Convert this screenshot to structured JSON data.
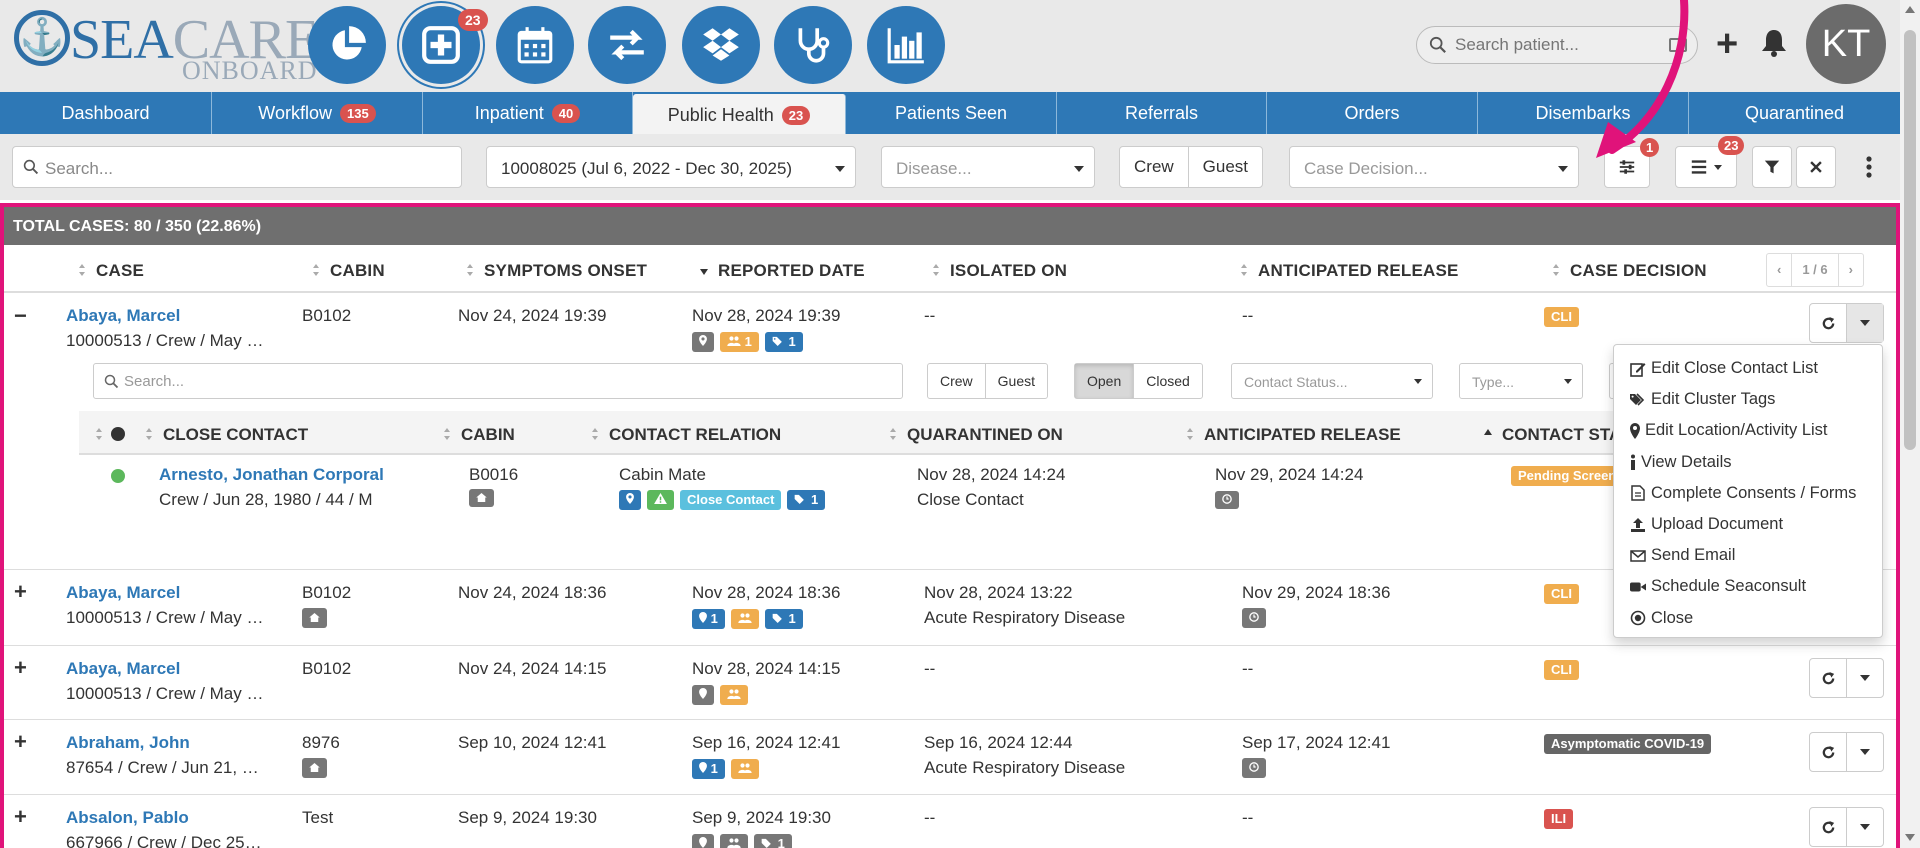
{
  "logo": {
    "sea": "SEA",
    "care": "CARE",
    "sub": "ONBOARD"
  },
  "top_nav": {
    "icons": [
      "pie-chart-icon",
      "add-case-icon",
      "calendar-icon",
      "transfer-icon",
      "dropbox-icon",
      "stethoscope-icon",
      "bar-chart-icon"
    ],
    "badge": "23",
    "search_placeholder": "Search patient...",
    "avatar_initials": "KT"
  },
  "tabs": [
    {
      "label": "Dashboard",
      "badge": ""
    },
    {
      "label": "Workflow",
      "badge": "135"
    },
    {
      "label": "Inpatient",
      "badge": "40"
    },
    {
      "label": "Public Health",
      "badge": "23"
    },
    {
      "label": "Patients Seen",
      "badge": ""
    },
    {
      "label": "Referrals",
      "badge": ""
    },
    {
      "label": "Orders",
      "badge": ""
    },
    {
      "label": "Disembarks",
      "badge": ""
    },
    {
      "label": "Quarantined",
      "badge": ""
    }
  ],
  "filters": {
    "search_placeholder": "Search...",
    "voyage": "10008025 (Jul 6, 2022 - Dec 30, 2025)",
    "disease_placeholder": "Disease...",
    "crew": "Crew",
    "guest": "Guest",
    "case_decision_placeholder": "Case Decision...",
    "adjust_badge": "1",
    "columns_badge": "23"
  },
  "table": {
    "total": "TOTAL CASES: 80 / 350 (22.86%)",
    "headers": [
      "CASE",
      "CABIN",
      "SYMPTOMS ONSET",
      "REPORTED DATE",
      "ISOLATED ON",
      "ANTICIPATED RELEASE",
      "CASE DECISION"
    ],
    "pager": {
      "prev": "‹",
      "page": "1 / 6",
      "next": "›"
    },
    "rows": [
      {
        "toggle": "−",
        "name": "Abaya, Marcel",
        "sub": "10000513 / Crew / May …",
        "cabin": "B0102",
        "onset": "Nov 24, 2024 19:39",
        "reported": "Nov 28, 2024 19:39",
        "isolated": "--",
        "isolated_sub": "",
        "release": "--",
        "decision": "CLI"
      },
      {
        "toggle": "+",
        "name": "Abaya, Marcel",
        "sub": "10000513 / Crew / May …",
        "cabin": "B0102",
        "onset": "Nov 24, 2024 18:36",
        "reported": "Nov 28, 2024 18:36",
        "isolated": "Nov 28, 2024 13:22",
        "isolated_sub": "Acute Respiratory Disease",
        "release": "Nov 29, 2024 18:36",
        "decision": "CLI"
      },
      {
        "toggle": "+",
        "name": "Abaya, Marcel",
        "sub": "10000513 / Crew / May …",
        "cabin": "B0102",
        "onset": "Nov 24, 2024 14:15",
        "reported": "Nov 28, 2024 14:15",
        "isolated": "--",
        "isolated_sub": "",
        "release": "--",
        "decision": "CLI"
      },
      {
        "toggle": "+",
        "name": "Abraham, John",
        "sub": "87654 / Crew / Jun 21, …",
        "cabin": "8976",
        "onset": "Sep 10, 2024 12:41",
        "reported": "Sep 16, 2024 12:41",
        "isolated": "Sep 16, 2024 12:44",
        "isolated_sub": "Acute Respiratory Disease",
        "release": "Sep 17, 2024 12:41",
        "decision": "Asymptomatic COVID-19"
      },
      {
        "toggle": "+",
        "name": "Absalon, Pablo",
        "sub": "667966 / Crew / Dec 25…",
        "cabin": "Test",
        "onset": "Sep 9, 2024 19:30",
        "reported": "Sep 9, 2024 19:30",
        "isolated": "--",
        "isolated_sub": "",
        "release": "--",
        "decision": "ILI"
      }
    ],
    "row_tags": {
      "r0": [
        "1",
        "1"
      ],
      "r1": [
        "1",
        "1"
      ],
      "r4": [
        "1"
      ]
    }
  },
  "nested": {
    "search_placeholder": "Search...",
    "crew": "Crew",
    "guest": "Guest",
    "open": "Open",
    "closed": "Closed",
    "contact_status_placeholder": "Contact Status...",
    "type_placeholder": "Type...",
    "headers": [
      "CLOSE CONTACT",
      "CABIN",
      "CONTACT RELATION",
      "QUARANTINED ON",
      "ANTICIPATED RELEASE",
      "CONTACT STA"
    ],
    "contact": {
      "name": "Arnesto, Jonathan Corporal",
      "sub": "Crew / Jun 28, 1980 / 44 / M",
      "cabin": "B0016",
      "relation": "Cabin Mate",
      "relation_tag": "Close Contact",
      "relation_tag_count": "1",
      "quarantined": "Nov 28, 2024 14:24",
      "quarantined_sub": "Close Contact",
      "release": "Nov 29, 2024 14:24",
      "status": "Pending Screen"
    }
  },
  "menu": {
    "items": [
      {
        "label": "Edit Close Contact List",
        "icon": "edit-icon"
      },
      {
        "label": "Edit Cluster Tags",
        "icon": "tags-icon"
      },
      {
        "label": "Edit Location/Activity List",
        "icon": "map-marker-icon"
      },
      {
        "label": "View Details",
        "icon": "info-icon"
      },
      {
        "label": "Complete Consents / Forms",
        "icon": "file-icon"
      },
      {
        "label": "Upload Document",
        "icon": "upload-icon"
      },
      {
        "label": "Send Email",
        "icon": "envelope-icon"
      },
      {
        "label": "Schedule Seaconsult",
        "icon": "video-camera-icon"
      },
      {
        "label": "Close",
        "icon": "dot-circle-icon"
      }
    ]
  },
  "colors": {
    "primary": "#2e78b6",
    "danger": "#d9534f",
    "warning": "#f0ad4e",
    "highlight": "#e0137a",
    "success": "#5cb85c"
  }
}
